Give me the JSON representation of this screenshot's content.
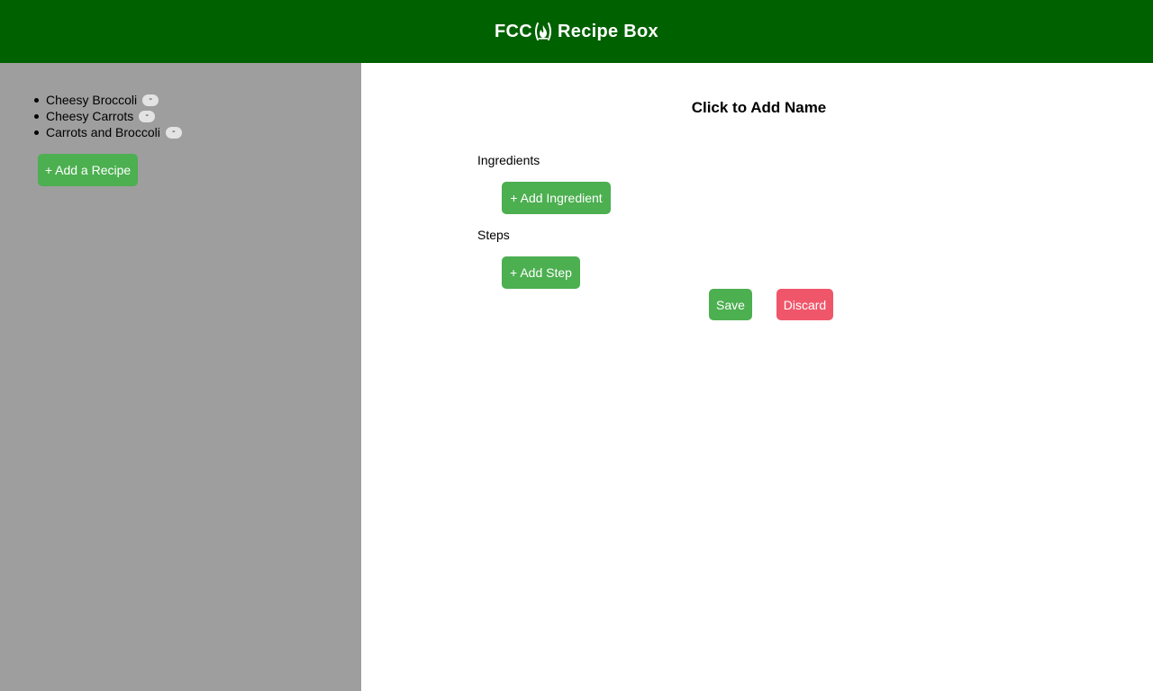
{
  "header": {
    "title_prefix": "FCC",
    "logo_icon": "freecodecamp-fire-icon",
    "title_suffix": "Recipe Box",
    "background": "#006100"
  },
  "sidebar": {
    "background": "#9e9e9e",
    "recipes": [
      {
        "name": "Cheesy Broccoli",
        "remove_label": "-"
      },
      {
        "name": "Cheesy Carrots",
        "remove_label": "-"
      },
      {
        "name": "Carrots and Broccoli",
        "remove_label": "-"
      }
    ],
    "add_recipe_label": "+ Add a Recipe"
  },
  "editor": {
    "name_placeholder": "Click to Add Name",
    "ingredients_label": "Ingredients",
    "add_ingredient_label": "+ Add Ingredient",
    "steps_label": "Steps",
    "add_step_label": "+ Add Step",
    "save_label": "Save",
    "discard_label": "Discard"
  },
  "colors": {
    "accent_green": "#4caf50",
    "discard_red": "#f0566a"
  }
}
